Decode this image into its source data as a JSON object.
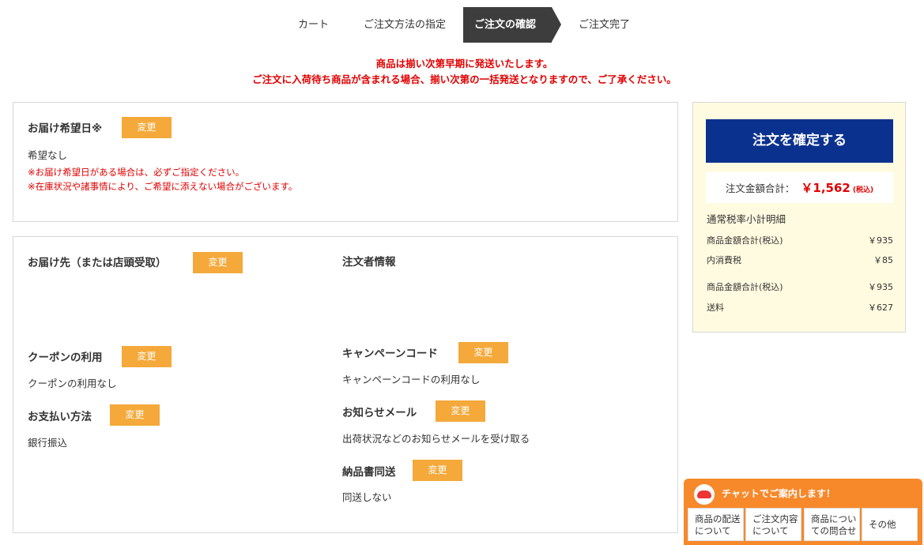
{
  "steps": [
    "カート",
    "ご注文方法の指定",
    "ご注文の確認",
    "ご注文完了"
  ],
  "notice": {
    "line1": "商品は揃い次第早期に発送いたします。",
    "line2": "ご注文に入荷待ち商品が含まれる場合、揃い次第の一括発送となりますので、ご了承ください。"
  },
  "delivery_date": {
    "heading": "お届け希望日※",
    "change_label": "変更",
    "value": "希望なし",
    "warning1": "※お届け希望日がある場合は、必ずご指定ください。",
    "warning2": "※在庫状況や諸事情により、ご希望に添えない場合がございます。"
  },
  "shipping_address": {
    "heading": "お届け先（または店頭受取）",
    "change_label": "変更"
  },
  "orderer": {
    "heading": "注文者情報"
  },
  "coupon": {
    "heading": "クーポンの利用",
    "change_label": "変更",
    "value": "クーポンの利用なし"
  },
  "campaign": {
    "heading": "キャンペーンコード",
    "change_label": "変更",
    "value": "キャンペーンコードの利用なし"
  },
  "payment": {
    "heading": "お支払い方法",
    "change_label": "変更",
    "value": "銀行振込"
  },
  "notify_mail": {
    "heading": "お知らせメール",
    "change_label": "変更",
    "value": "出荷状況などのお知らせメールを受け取る"
  },
  "invoice": {
    "heading": "納品書同送",
    "change_label": "変更",
    "value": "同送しない"
  },
  "summary": {
    "confirm_label": "注文を確定する",
    "total_label": "注文金額合計：",
    "total_amount": "￥1,562",
    "total_tax_note": "(税込)",
    "breakdown_title": "通常税率小計明細",
    "rows": [
      {
        "label": "商品金額合計(税込)",
        "value": "￥935"
      },
      {
        "label": "内消費税",
        "value": "￥85"
      },
      {
        "label": "商品金額合計(税込)",
        "value": "￥935"
      },
      {
        "label": "送料",
        "value": "￥627"
      }
    ]
  },
  "chat": {
    "title": "チャットでご案内します！",
    "buttons": [
      {
        "line1": "商品の配送",
        "line2": "について"
      },
      {
        "line1": "ご注文内容",
        "line2": "について"
      },
      {
        "line1": "商品につい",
        "line2": "ての問合せ"
      },
      {
        "line1": "その他",
        "line2": ""
      }
    ]
  },
  "colors": {
    "accent_orange": "#f4a93a",
    "confirm_navy": "#0b318f",
    "warning_red": "#e00000",
    "summary_bg": "#fffbe0",
    "chat_orange": "#f7892b"
  }
}
